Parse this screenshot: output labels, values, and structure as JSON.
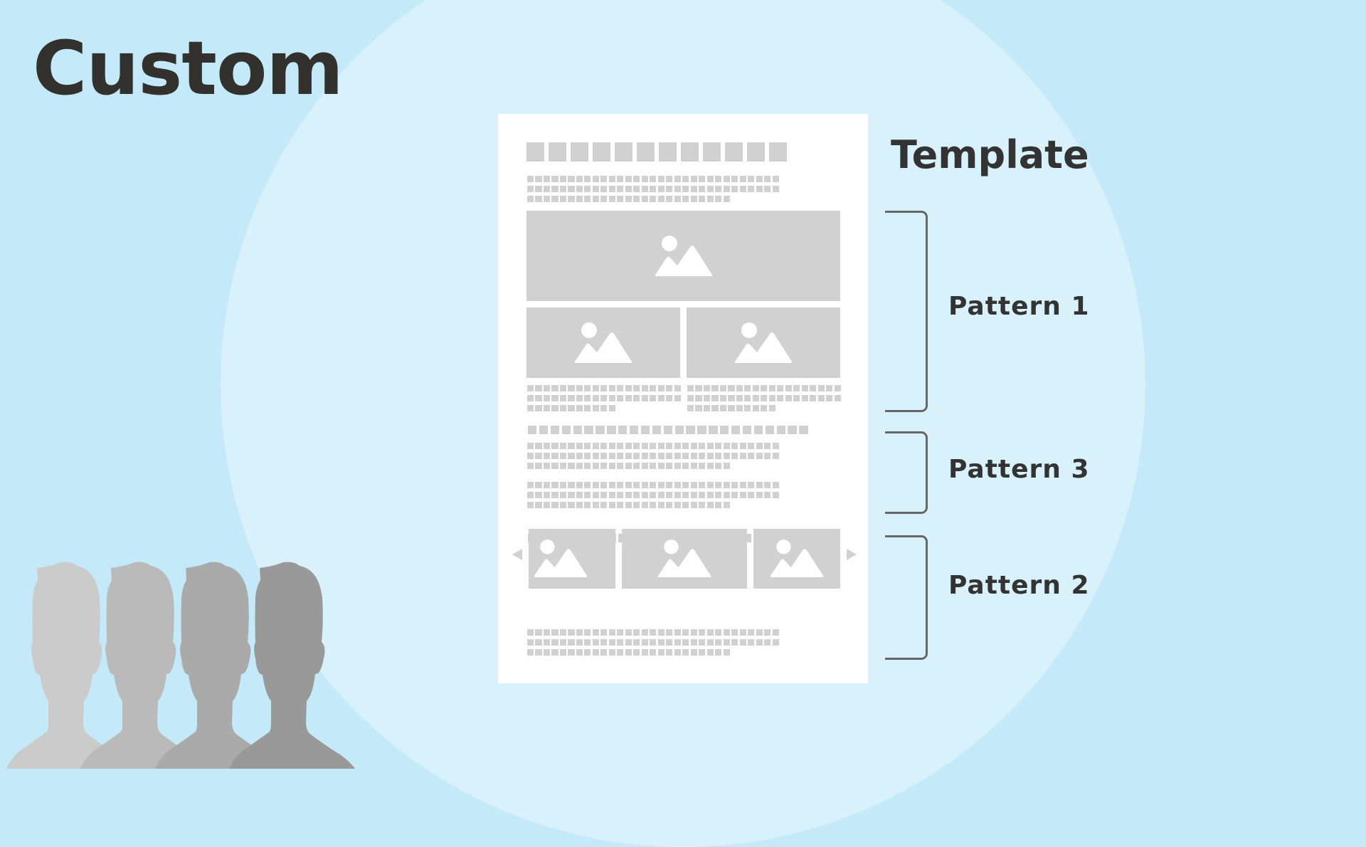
{
  "title": "Custom",
  "template_label": "Template",
  "patterns": [
    {
      "label": "Pattern 1",
      "section": "hero-image-and-two-column-images"
    },
    {
      "label": "Pattern 3",
      "section": "heading-and-text-paragraphs"
    },
    {
      "label": "Pattern 2",
      "section": "image-carousel"
    }
  ],
  "icons": {
    "image_placeholder": "image-icon",
    "carousel_prev": "chevron-left-icon",
    "carousel_next": "chevron-right-icon",
    "people": "person-silhouette-icon"
  },
  "colors": {
    "background": "#c4eaf9",
    "circle": "#d8f1fb",
    "document": "#ffffff",
    "placeholder": "#d1d1d1",
    "text_dark": "#33312d",
    "bracket": "#666666",
    "people": [
      "#cbcbcb",
      "#bababa",
      "#aaaaaa",
      "#999999"
    ]
  },
  "people_count": 4
}
